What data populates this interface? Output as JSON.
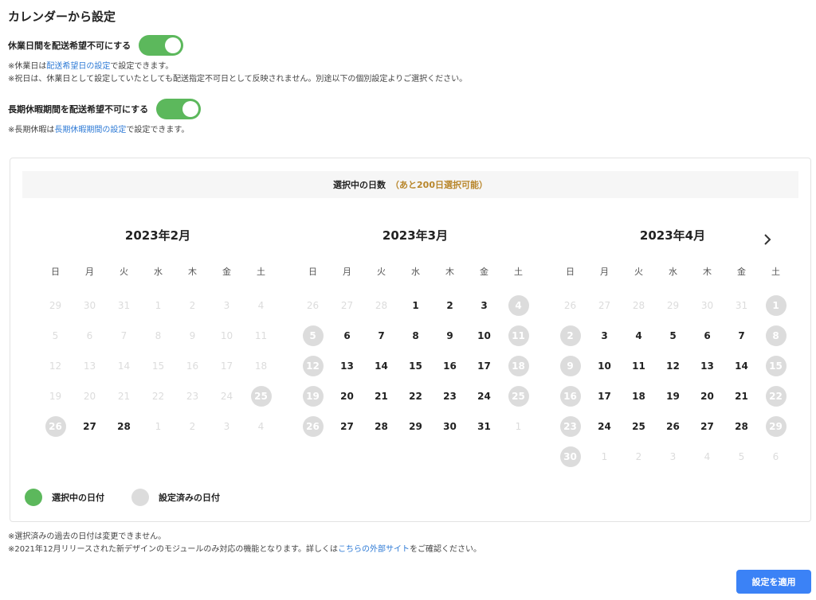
{
  "title": "カレンダーから設定",
  "holiday_toggle": {
    "label": "休業日間を配送希望不可にする",
    "on": true,
    "note1_prefix": "※休業日は",
    "note1_link": "配送希望日の設定",
    "note1_suffix": "で設定できます。",
    "note2": "※祝日は、休業日として設定していたとしても配送指定不可日として反映されません。別途以下の個別設定よりご選択ください。"
  },
  "vacation_toggle": {
    "label": "長期休暇期間を配送希望不可にする",
    "on": true,
    "note_prefix": "※長期休暇は",
    "note_link": "長期休暇期間の設定",
    "note_suffix": "で設定できます。"
  },
  "banner": {
    "label": "選択中の日数",
    "remaining": "（あと200日選択可能）"
  },
  "weekdays": [
    "日",
    "月",
    "火",
    "水",
    "木",
    "金",
    "土"
  ],
  "next_icon": "chevron-right-icon",
  "months": [
    {
      "title": "2023年2月",
      "days": [
        {
          "n": "29",
          "s": "faded"
        },
        {
          "n": "30",
          "s": "faded"
        },
        {
          "n": "31",
          "s": "faded"
        },
        {
          "n": "1",
          "s": "faded"
        },
        {
          "n": "2",
          "s": "faded"
        },
        {
          "n": "3",
          "s": "faded"
        },
        {
          "n": "4",
          "s": "faded"
        },
        {
          "n": "5",
          "s": "faded"
        },
        {
          "n": "6",
          "s": "faded"
        },
        {
          "n": "7",
          "s": "faded"
        },
        {
          "n": "8",
          "s": "faded"
        },
        {
          "n": "9",
          "s": "faded"
        },
        {
          "n": "10",
          "s": "faded"
        },
        {
          "n": "11",
          "s": "faded"
        },
        {
          "n": "12",
          "s": "faded"
        },
        {
          "n": "13",
          "s": "faded"
        },
        {
          "n": "14",
          "s": "faded"
        },
        {
          "n": "15",
          "s": "faded"
        },
        {
          "n": "16",
          "s": "faded"
        },
        {
          "n": "17",
          "s": "faded"
        },
        {
          "n": "18",
          "s": "faded"
        },
        {
          "n": "19",
          "s": "faded"
        },
        {
          "n": "20",
          "s": "faded"
        },
        {
          "n": "21",
          "s": "faded"
        },
        {
          "n": "22",
          "s": "faded"
        },
        {
          "n": "23",
          "s": "faded"
        },
        {
          "n": "24",
          "s": "faded"
        },
        {
          "n": "25",
          "s": "set"
        },
        {
          "n": "26",
          "s": "set"
        },
        {
          "n": "27",
          "s": "normal"
        },
        {
          "n": "28",
          "s": "normal"
        },
        {
          "n": "1",
          "s": "faded"
        },
        {
          "n": "2",
          "s": "faded"
        },
        {
          "n": "3",
          "s": "faded"
        },
        {
          "n": "4",
          "s": "faded"
        }
      ]
    },
    {
      "title": "2023年3月",
      "days": [
        {
          "n": "26",
          "s": "faded"
        },
        {
          "n": "27",
          "s": "faded"
        },
        {
          "n": "28",
          "s": "faded"
        },
        {
          "n": "1",
          "s": "normal"
        },
        {
          "n": "2",
          "s": "normal"
        },
        {
          "n": "3",
          "s": "normal"
        },
        {
          "n": "4",
          "s": "set"
        },
        {
          "n": "5",
          "s": "set"
        },
        {
          "n": "6",
          "s": "normal"
        },
        {
          "n": "7",
          "s": "normal"
        },
        {
          "n": "8",
          "s": "normal"
        },
        {
          "n": "9",
          "s": "normal"
        },
        {
          "n": "10",
          "s": "normal"
        },
        {
          "n": "11",
          "s": "set"
        },
        {
          "n": "12",
          "s": "set"
        },
        {
          "n": "13",
          "s": "normal"
        },
        {
          "n": "14",
          "s": "normal"
        },
        {
          "n": "15",
          "s": "normal"
        },
        {
          "n": "16",
          "s": "normal"
        },
        {
          "n": "17",
          "s": "normal"
        },
        {
          "n": "18",
          "s": "set"
        },
        {
          "n": "19",
          "s": "set"
        },
        {
          "n": "20",
          "s": "normal"
        },
        {
          "n": "21",
          "s": "normal"
        },
        {
          "n": "22",
          "s": "normal"
        },
        {
          "n": "23",
          "s": "normal"
        },
        {
          "n": "24",
          "s": "normal"
        },
        {
          "n": "25",
          "s": "set"
        },
        {
          "n": "26",
          "s": "set"
        },
        {
          "n": "27",
          "s": "normal"
        },
        {
          "n": "28",
          "s": "normal"
        },
        {
          "n": "29",
          "s": "normal"
        },
        {
          "n": "30",
          "s": "normal"
        },
        {
          "n": "31",
          "s": "normal"
        },
        {
          "n": "1",
          "s": "faded"
        }
      ]
    },
    {
      "title": "2023年4月",
      "days": [
        {
          "n": "26",
          "s": "faded"
        },
        {
          "n": "27",
          "s": "faded"
        },
        {
          "n": "28",
          "s": "faded"
        },
        {
          "n": "29",
          "s": "faded"
        },
        {
          "n": "30",
          "s": "faded"
        },
        {
          "n": "31",
          "s": "faded"
        },
        {
          "n": "1",
          "s": "set"
        },
        {
          "n": "2",
          "s": "set"
        },
        {
          "n": "3",
          "s": "normal"
        },
        {
          "n": "4",
          "s": "normal"
        },
        {
          "n": "5",
          "s": "normal"
        },
        {
          "n": "6",
          "s": "normal"
        },
        {
          "n": "7",
          "s": "normal"
        },
        {
          "n": "8",
          "s": "set"
        },
        {
          "n": "9",
          "s": "set"
        },
        {
          "n": "10",
          "s": "normal"
        },
        {
          "n": "11",
          "s": "normal"
        },
        {
          "n": "12",
          "s": "normal"
        },
        {
          "n": "13",
          "s": "normal"
        },
        {
          "n": "14",
          "s": "normal"
        },
        {
          "n": "15",
          "s": "set"
        },
        {
          "n": "16",
          "s": "set"
        },
        {
          "n": "17",
          "s": "normal"
        },
        {
          "n": "18",
          "s": "normal"
        },
        {
          "n": "19",
          "s": "normal"
        },
        {
          "n": "20",
          "s": "normal"
        },
        {
          "n": "21",
          "s": "normal"
        },
        {
          "n": "22",
          "s": "set"
        },
        {
          "n": "23",
          "s": "set"
        },
        {
          "n": "24",
          "s": "normal"
        },
        {
          "n": "25",
          "s": "normal"
        },
        {
          "n": "26",
          "s": "normal"
        },
        {
          "n": "27",
          "s": "normal"
        },
        {
          "n": "28",
          "s": "normal"
        },
        {
          "n": "29",
          "s": "set"
        },
        {
          "n": "30",
          "s": "set"
        },
        {
          "n": "1",
          "s": "faded"
        },
        {
          "n": "2",
          "s": "faded"
        },
        {
          "n": "3",
          "s": "faded"
        },
        {
          "n": "4",
          "s": "faded"
        },
        {
          "n": "5",
          "s": "faded"
        },
        {
          "n": "6",
          "s": "faded"
        }
      ]
    }
  ],
  "legend": {
    "selected_label": "選択中の日付",
    "selected_color": "#5cb85c",
    "set_label": "設定済みの日付",
    "set_color": "#dcdcdc"
  },
  "footer": {
    "note1": "※選択済みの過去の日付は変更できません。",
    "note2_prefix": "※2021年12月リリースされた新デザインのモジュールのみ対応の機能となります。詳しくは",
    "note2_link": "こちらの外部サイト",
    "note2_suffix": "をご確認ください。"
  },
  "apply_button": "設定を適用",
  "colors": {
    "accent": "#3b82f6",
    "toggle_on": "#5cb85c",
    "link": "#2f7bd6",
    "remaining": "#b8862b"
  }
}
